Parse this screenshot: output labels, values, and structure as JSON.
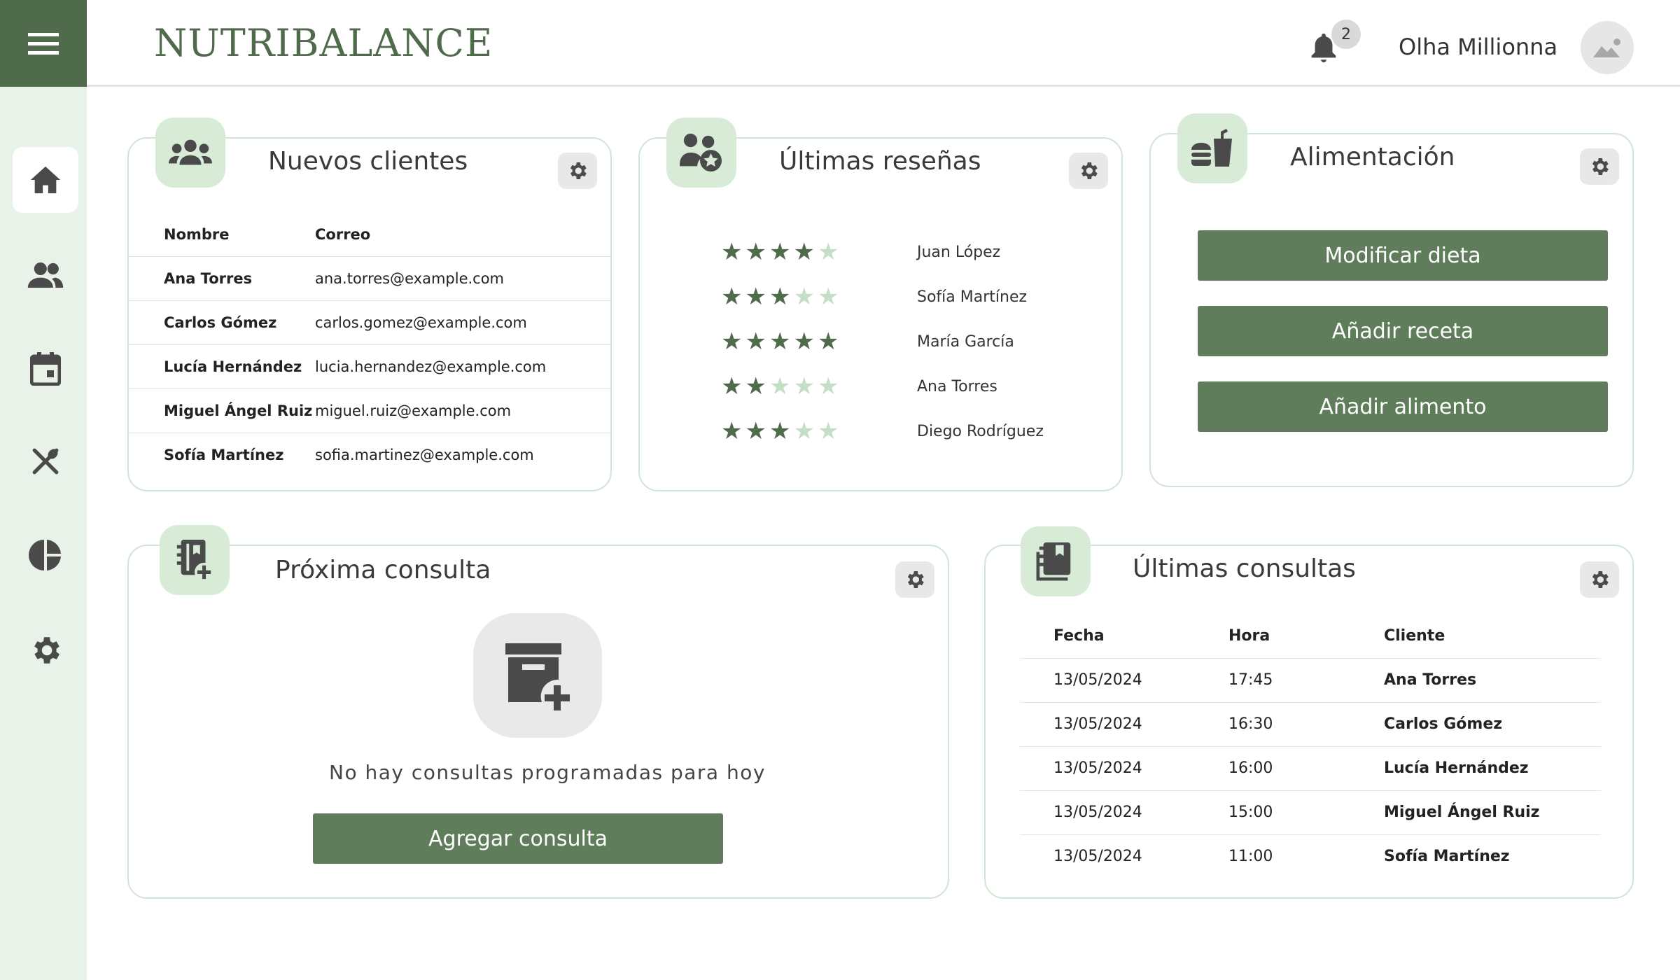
{
  "app": {
    "brand": "NUTRIBALANCE",
    "user_name": "Olha Millionna",
    "notification_count": "2"
  },
  "sidebar": {
    "items": [
      {
        "name": "home",
        "active": true
      },
      {
        "name": "clients"
      },
      {
        "name": "calendar"
      },
      {
        "name": "food"
      },
      {
        "name": "stats"
      },
      {
        "name": "settings"
      }
    ]
  },
  "new_clients": {
    "title": "Nuevos clientes",
    "columns": [
      "Nombre",
      "Correo"
    ],
    "rows": [
      {
        "name": "Ana Torres",
        "email": "ana.torres@example.com"
      },
      {
        "name": "Carlos Gómez",
        "email": "carlos.gomez@example.com"
      },
      {
        "name": "Lucía Hernández",
        "email": "lucia.hernandez@example.com"
      },
      {
        "name": "Miguel Ángel Ruiz",
        "email": "miguel.ruiz@example.com"
      },
      {
        "name": "Sofía Martínez",
        "email": "sofia.martinez@example.com"
      }
    ]
  },
  "reviews": {
    "title": "Últimas reseñas",
    "items": [
      {
        "name": "Juan López",
        "rating": 4,
        "max": 5
      },
      {
        "name": "Sofía Martínez",
        "rating": 3,
        "max": 5
      },
      {
        "name": "María García",
        "rating": 5,
        "max": 5
      },
      {
        "name": "Ana Torres",
        "rating": 2,
        "max": 5
      },
      {
        "name": "Diego Rodríguez",
        "rating": 3,
        "max": 5
      }
    ]
  },
  "food": {
    "title": "Alimentación",
    "buttons": [
      "Modificar dieta",
      "Añadir receta",
      "Añadir alimento"
    ]
  },
  "next_consult": {
    "title": "Próxima consulta",
    "empty_text": "No hay consultas programadas para hoy",
    "add_button": "Agregar consulta"
  },
  "last_consults": {
    "title": "Últimas consultas",
    "columns": [
      "Fecha",
      "Hora",
      "Cliente"
    ],
    "rows": [
      {
        "date": "13/05/2024",
        "time": "17:45",
        "client": "Ana Torres"
      },
      {
        "date": "13/05/2024",
        "time": "16:30",
        "client": "Carlos Gómez"
      },
      {
        "date": "13/05/2024",
        "time": "16:00",
        "client": "Lucía Hernández"
      },
      {
        "date": "13/05/2024",
        "time": "15:00",
        "client": "Miguel Ángel Ruiz"
      },
      {
        "date": "13/05/2024",
        "time": "11:00",
        "client": "Sofía Martínez"
      }
    ]
  },
  "colors": {
    "accent": "#4f6b4b",
    "button": "#5f7d5a",
    "sidebar_bg": "#e8f2e8",
    "icon_bg": "#d7ebd7",
    "star_on": "#4f6b4b",
    "star_off": "#c5dfc5"
  }
}
